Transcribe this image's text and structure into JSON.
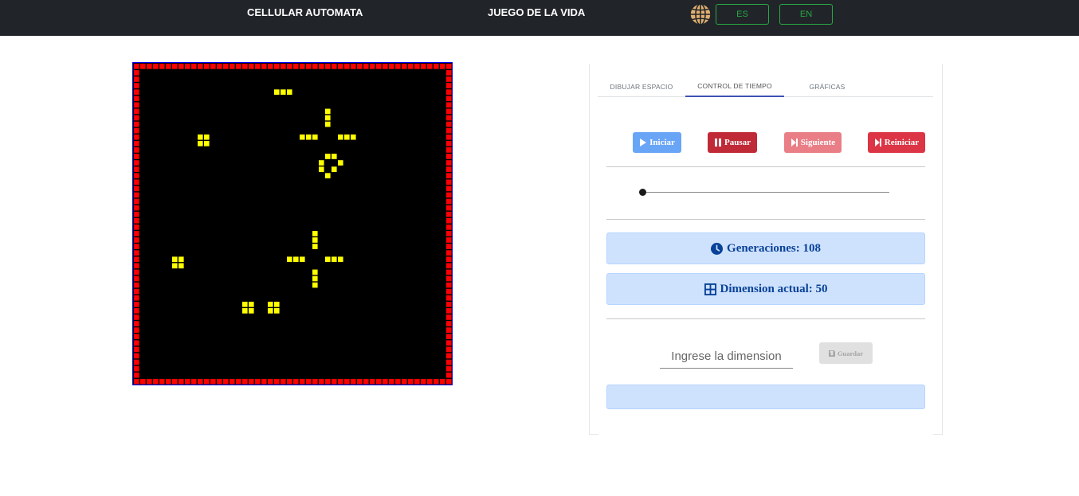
{
  "nav": {
    "cellular_automata": "CELLULAR AUTOMATA",
    "game_of_life": "JUEGO DE LA VIDA",
    "lang_es": "ES",
    "lang_en": "EN",
    "globe_icon": "globe-icon"
  },
  "colors": {
    "navbar": "#212529",
    "border_cells": "#ff0000",
    "live_cells": "#ffff00",
    "dead_cells": "#000000",
    "accent": "#28a745",
    "info_bg": "#cfe2fd",
    "info_text": "#084298"
  },
  "tabs": [
    {
      "label": "DIBUJAR ESPACIO",
      "active": false
    },
    {
      "label": "CONTROL DE TIEMPO",
      "active": true
    },
    {
      "label": "GRÁFICAS",
      "active": false
    }
  ],
  "controls": {
    "start": "Iniciar",
    "pause": "Pausar",
    "next": "Siguiente",
    "reset": "Reiniciar"
  },
  "speed_slider": {
    "value": 0
  },
  "stats": {
    "generations_label": "Generaciones: 108",
    "dimension_label": "Dimension actual: 50"
  },
  "dimension_form": {
    "placeholder": "Ingrese la dimension",
    "save_label": "Guardar"
  },
  "grid": {
    "size": 50,
    "live_cells": [
      [
        4,
        22
      ],
      [
        4,
        23
      ],
      [
        4,
        24
      ],
      [
        7,
        30
      ],
      [
        8,
        30
      ],
      [
        9,
        30
      ],
      [
        11,
        26
      ],
      [
        11,
        27
      ],
      [
        11,
        28
      ],
      [
        11,
        32
      ],
      [
        11,
        33
      ],
      [
        11,
        34
      ],
      [
        11,
        10
      ],
      [
        11,
        11
      ],
      [
        12,
        10
      ],
      [
        12,
        11
      ],
      [
        14,
        30
      ],
      [
        14,
        31
      ],
      [
        15,
        29
      ],
      [
        15,
        32
      ],
      [
        16,
        29
      ],
      [
        16,
        31
      ],
      [
        17,
        30
      ],
      [
        26,
        28
      ],
      [
        27,
        28
      ],
      [
        28,
        28
      ],
      [
        30,
        24
      ],
      [
        30,
        25
      ],
      [
        30,
        26
      ],
      [
        30,
        30
      ],
      [
        30,
        31
      ],
      [
        30,
        32
      ],
      [
        30,
        6
      ],
      [
        30,
        7
      ],
      [
        31,
        6
      ],
      [
        31,
        7
      ],
      [
        32,
        28
      ],
      [
        33,
        28
      ],
      [
        34,
        28
      ],
      [
        37,
        17
      ],
      [
        37,
        18
      ],
      [
        38,
        17
      ],
      [
        38,
        18
      ],
      [
        37,
        21
      ],
      [
        37,
        22
      ],
      [
        38,
        21
      ],
      [
        38,
        22
      ]
    ]
  }
}
